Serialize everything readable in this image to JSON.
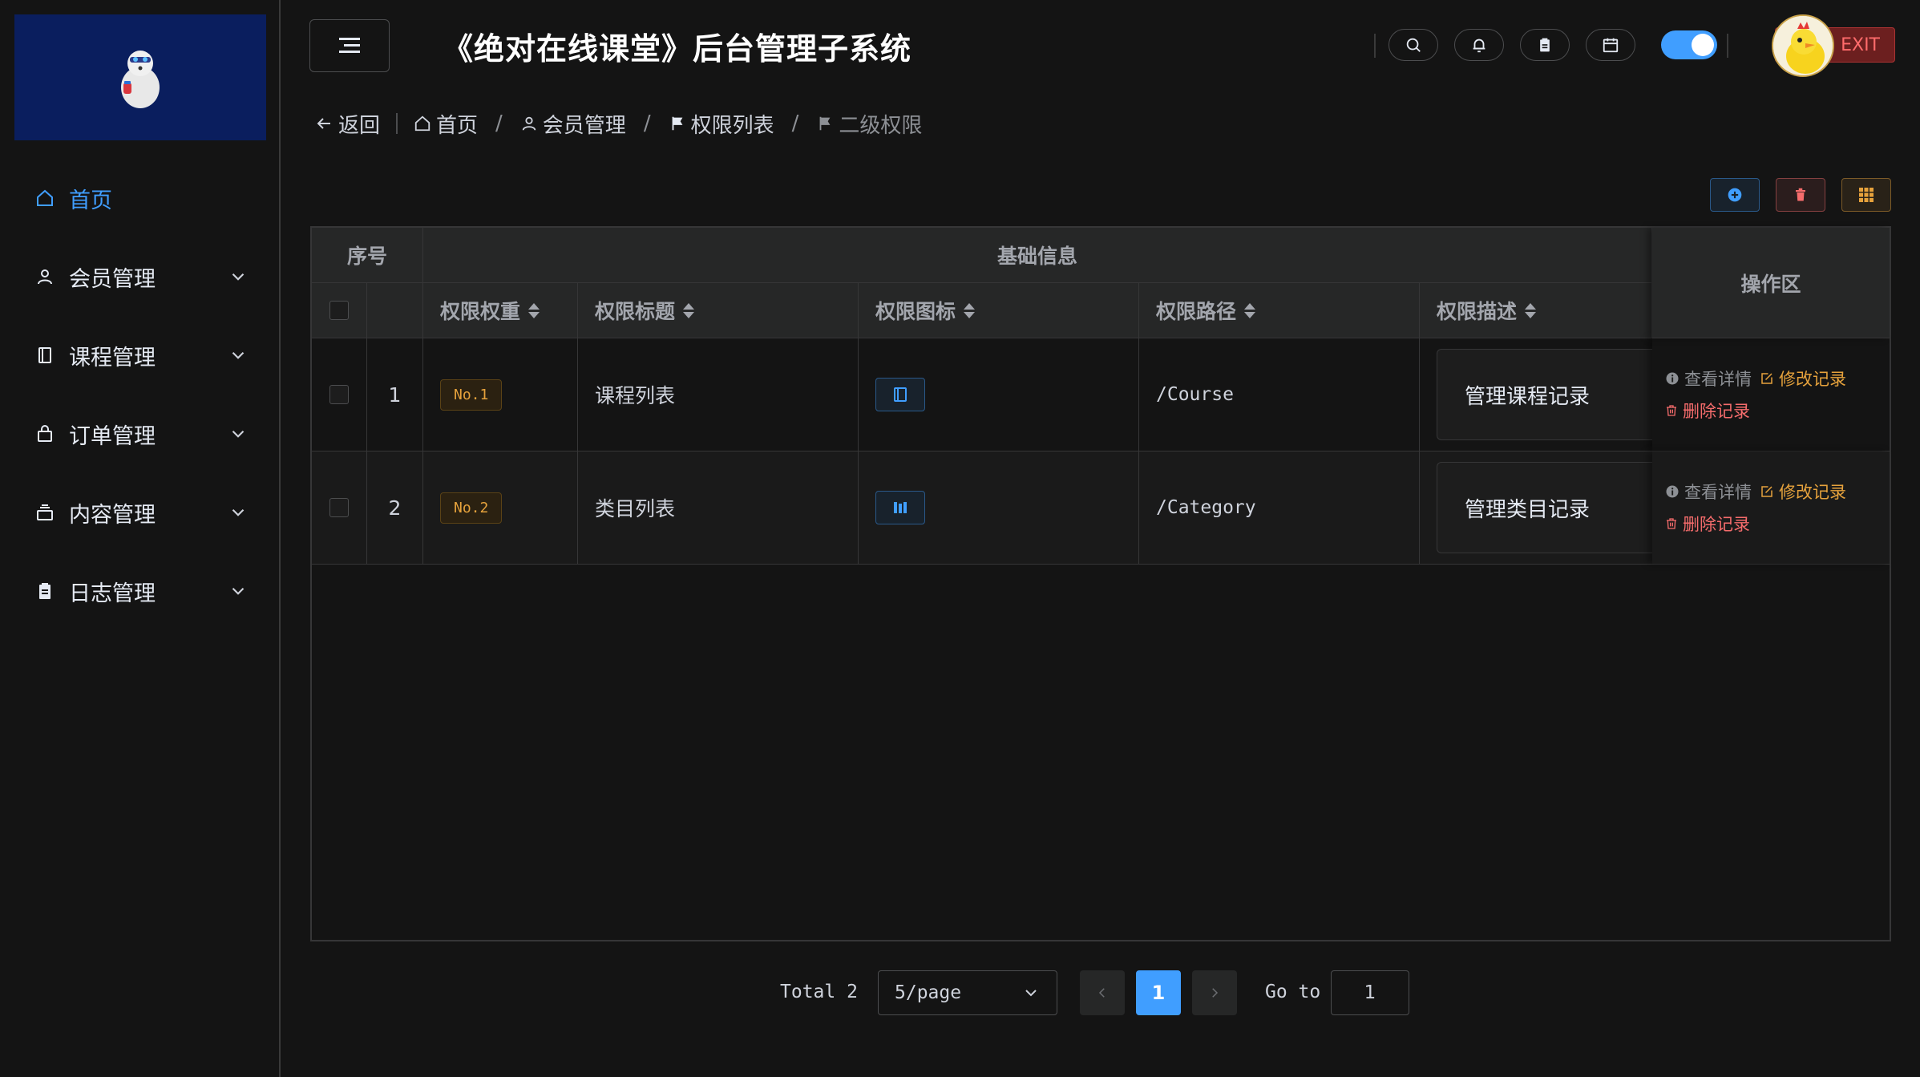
{
  "header": {
    "title": "《绝对在线课堂》后台管理子系统",
    "exit_label": "EXIT",
    "icons": [
      "search-icon",
      "bell-icon",
      "clipboard-icon",
      "calendar-icon"
    ],
    "dark_mode_enabled": true
  },
  "sidebar": {
    "items": [
      {
        "label": "首页",
        "icon": "home-icon",
        "active": true
      },
      {
        "label": "会员管理",
        "icon": "user-icon"
      },
      {
        "label": "课程管理",
        "icon": "book-icon"
      },
      {
        "label": "订单管理",
        "icon": "bag-icon"
      },
      {
        "label": "内容管理",
        "icon": "box-icon"
      },
      {
        "label": "日志管理",
        "icon": "document-icon"
      }
    ]
  },
  "breadcrumb": {
    "back": "返回",
    "items": [
      "首页",
      "会员管理",
      "权限列表",
      "二级权限"
    ]
  },
  "table": {
    "group_headers": {
      "index": "序号",
      "basic": "基础信息",
      "ops": "操作区"
    },
    "columns": [
      "权限权重",
      "权限标题",
      "权限图标",
      "权限路径",
      "权限描述"
    ],
    "rows": [
      {
        "index": "1",
        "weight": "No.1",
        "title": "课程列表",
        "icon": "book-icon",
        "path": "/Course",
        "desc": "管理课程记录"
      },
      {
        "index": "2",
        "weight": "No.2",
        "title": "类目列表",
        "icon": "category-icon",
        "path": "/Category",
        "desc": "管理类目记录"
      }
    ],
    "actions": {
      "view": "查看详情",
      "edit": "修改记录",
      "delete": "删除记录"
    }
  },
  "pagination": {
    "total": "Total 2",
    "page_size": "5/page",
    "current_page": "1",
    "goto_label": "Go to",
    "goto_value": "1"
  },
  "colors": {
    "accent": "#409eff",
    "warning": "#e6a23c",
    "danger": "#f56c6c",
    "logo_bg": "#0a1e5e"
  }
}
